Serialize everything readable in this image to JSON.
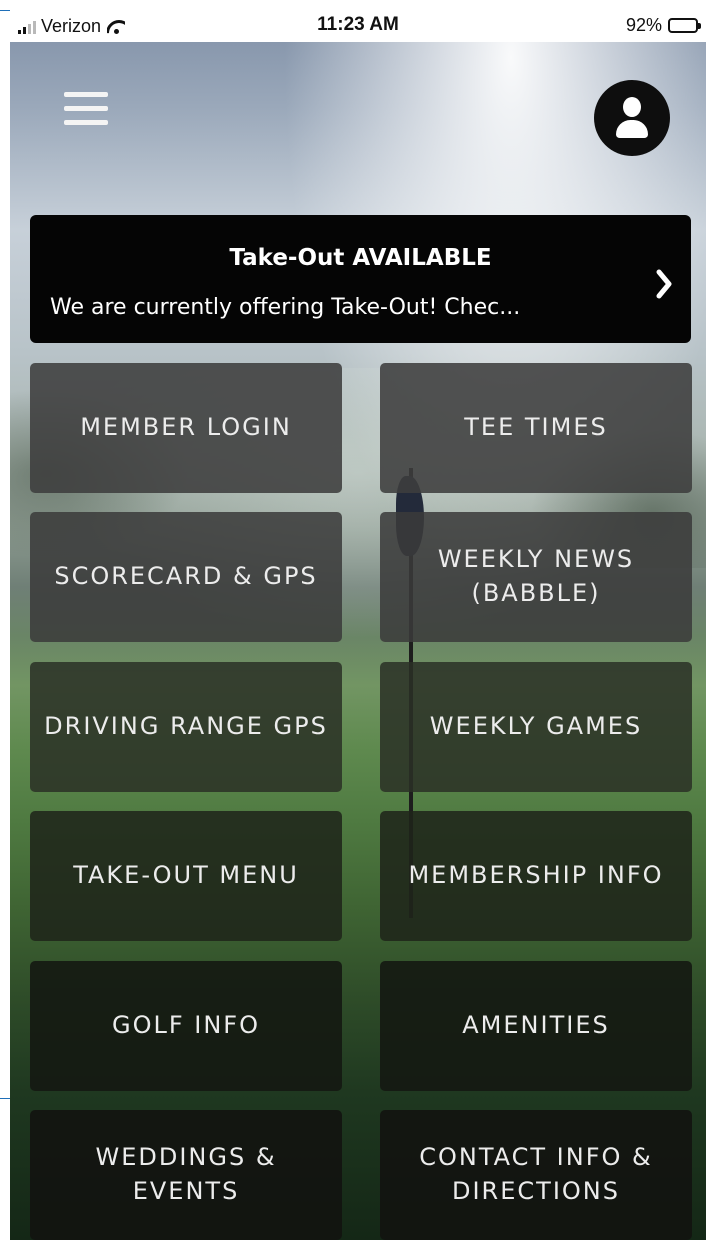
{
  "status_bar": {
    "carrier": "Verizon",
    "time": "11:23 AM",
    "battery": "92%",
    "battery_level": 0.92
  },
  "header": {
    "menu_icon": "hamburger-menu-icon",
    "profile_icon": "user-profile-icon"
  },
  "banner": {
    "title": "Take-Out AVAILABLE",
    "text": "We are currently offering Take-Out! Chec...",
    "chevron_icon": "chevron-right-icon"
  },
  "tiles": [
    {
      "label": "MEMBER LOGIN"
    },
    {
      "label": "TEE TIMES"
    },
    {
      "label": "SCORECARD & GPS"
    },
    {
      "label": "WEEKLY NEWS (BABBLE)"
    },
    {
      "label": "DRIVING RANGE GPS"
    },
    {
      "label": "WEEKLY GAMES"
    },
    {
      "label": "TAKE-OUT MENU"
    },
    {
      "label": "MEMBERSHIP INFO"
    },
    {
      "label": "GOLF INFO"
    },
    {
      "label": "AMENITIES"
    },
    {
      "label": "WEDDINGS & EVENTS"
    },
    {
      "label": "CONTACT INFO & DIRECTIONS"
    }
  ],
  "colors": {
    "tile_text": "#ececec",
    "banner_background": "#050505",
    "status_bar_background": "#ffffff"
  }
}
